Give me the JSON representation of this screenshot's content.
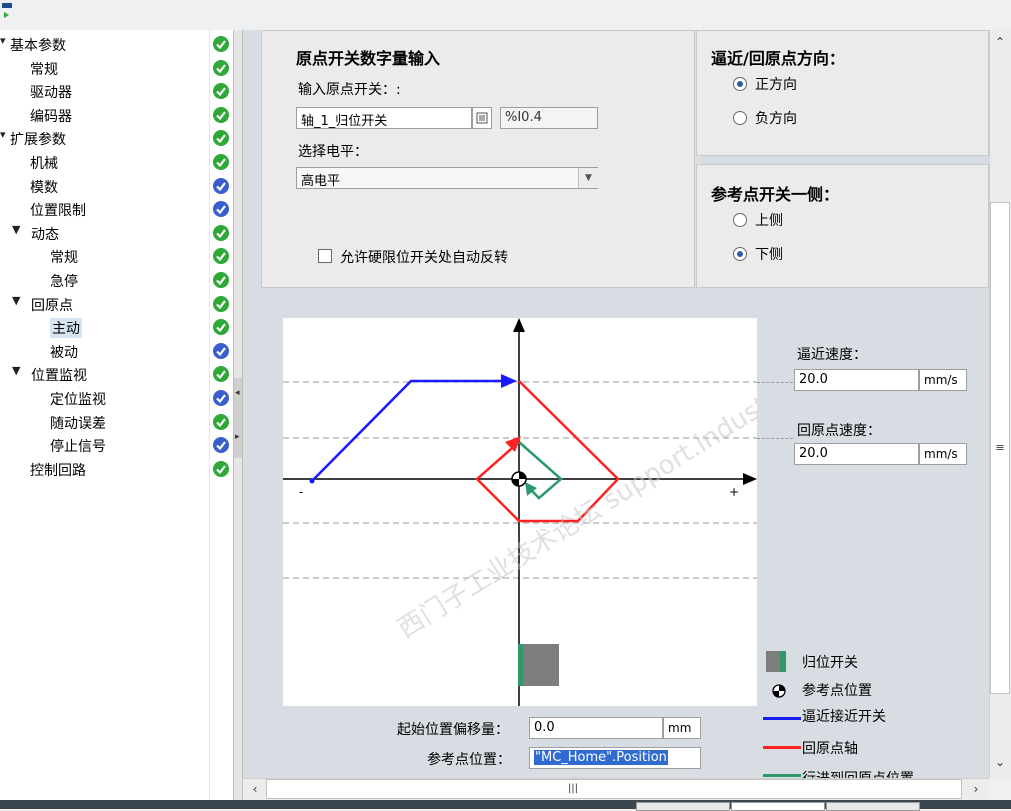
{
  "tree": {
    "items": [
      {
        "label": "基本参数",
        "arrow": "▾",
        "status": "green"
      },
      {
        "label": "常规",
        "arrow": "",
        "status": "green"
      },
      {
        "label": "驱动器",
        "arrow": "",
        "status": "green"
      },
      {
        "label": "编码器",
        "arrow": "",
        "status": "green"
      },
      {
        "label": "扩展参数",
        "arrow": "▾",
        "status": "green"
      },
      {
        "label": "机械",
        "arrow": "",
        "status": "green"
      },
      {
        "label": "模数",
        "arrow": "",
        "status": "blue"
      },
      {
        "label": "位置限制",
        "arrow": "",
        "status": "blue"
      },
      {
        "label": "动态",
        "arrow": "▼",
        "status": "green"
      },
      {
        "label": "常规",
        "arrow": "",
        "status": "green"
      },
      {
        "label": "急停",
        "arrow": "",
        "status": "green"
      },
      {
        "label": "回原点",
        "arrow": "▼",
        "status": "green"
      },
      {
        "label": "主动",
        "arrow": "",
        "status": "green",
        "selected": true
      },
      {
        "label": "被动",
        "arrow": "",
        "status": "blue"
      },
      {
        "label": "位置监视",
        "arrow": "▼",
        "status": "green"
      },
      {
        "label": "定位监视",
        "arrow": "",
        "status": "blue"
      },
      {
        "label": "随动误差",
        "arrow": "",
        "status": "green"
      },
      {
        "label": "停止信号",
        "arrow": "",
        "status": "blue"
      },
      {
        "label": "控制回路",
        "arrow": "",
        "status": "green"
      }
    ]
  },
  "home_switch_panel": {
    "title": "原点开关数字量输入",
    "input_label": "输入原点开关：:",
    "input_value": "轴_1_归位开关",
    "address_value": "%I0.4",
    "level_label": "选择电平：",
    "level_value": "高电平",
    "auto_reverse_label": "允许硬限位开关处自动反转"
  },
  "direction_panel": {
    "title": "逼近/回原点方向：",
    "options": [
      "正方向",
      "负方向"
    ],
    "selected": "正方向"
  },
  "ref_side_panel": {
    "title": "参考点开关一侧：",
    "options": [
      "上侧",
      "下侧"
    ],
    "selected": "下侧"
  },
  "speed": {
    "approach_label": "逼近速度：",
    "approach_value": "20.0",
    "approach_unit": "mm/s",
    "homing_label": "回原点速度：",
    "homing_value": "20.0",
    "homing_unit": "mm/s"
  },
  "diagram": {
    "minus": "-",
    "plus": "+"
  },
  "offset": {
    "label": "起始位置偏移量：",
    "value": "0.0",
    "unit": "mm"
  },
  "ref_position": {
    "label": "参考点位置：",
    "value": "\"MC_Home\".Position"
  },
  "legend": [
    {
      "label": "归位开关",
      "icon": "home-switch-icon"
    },
    {
      "label": "参考点位置",
      "icon": "reference-point-icon"
    },
    {
      "label": "逼近接近开关",
      "color": "#1a1aff"
    },
    {
      "label": "回原点轴",
      "color": "#ff2222"
    },
    {
      "label": "行进到回原点位置",
      "color": "#2e9a6b"
    }
  ],
  "watermark": "西门子工业技术论坛 support.industry.siemens.com/cs",
  "colors": {
    "approach": "#1a1aff",
    "homing": "#ff2222",
    "travel": "#2e9a6b",
    "status_green": "#2ea836",
    "status_blue": "#3a5fcd"
  }
}
